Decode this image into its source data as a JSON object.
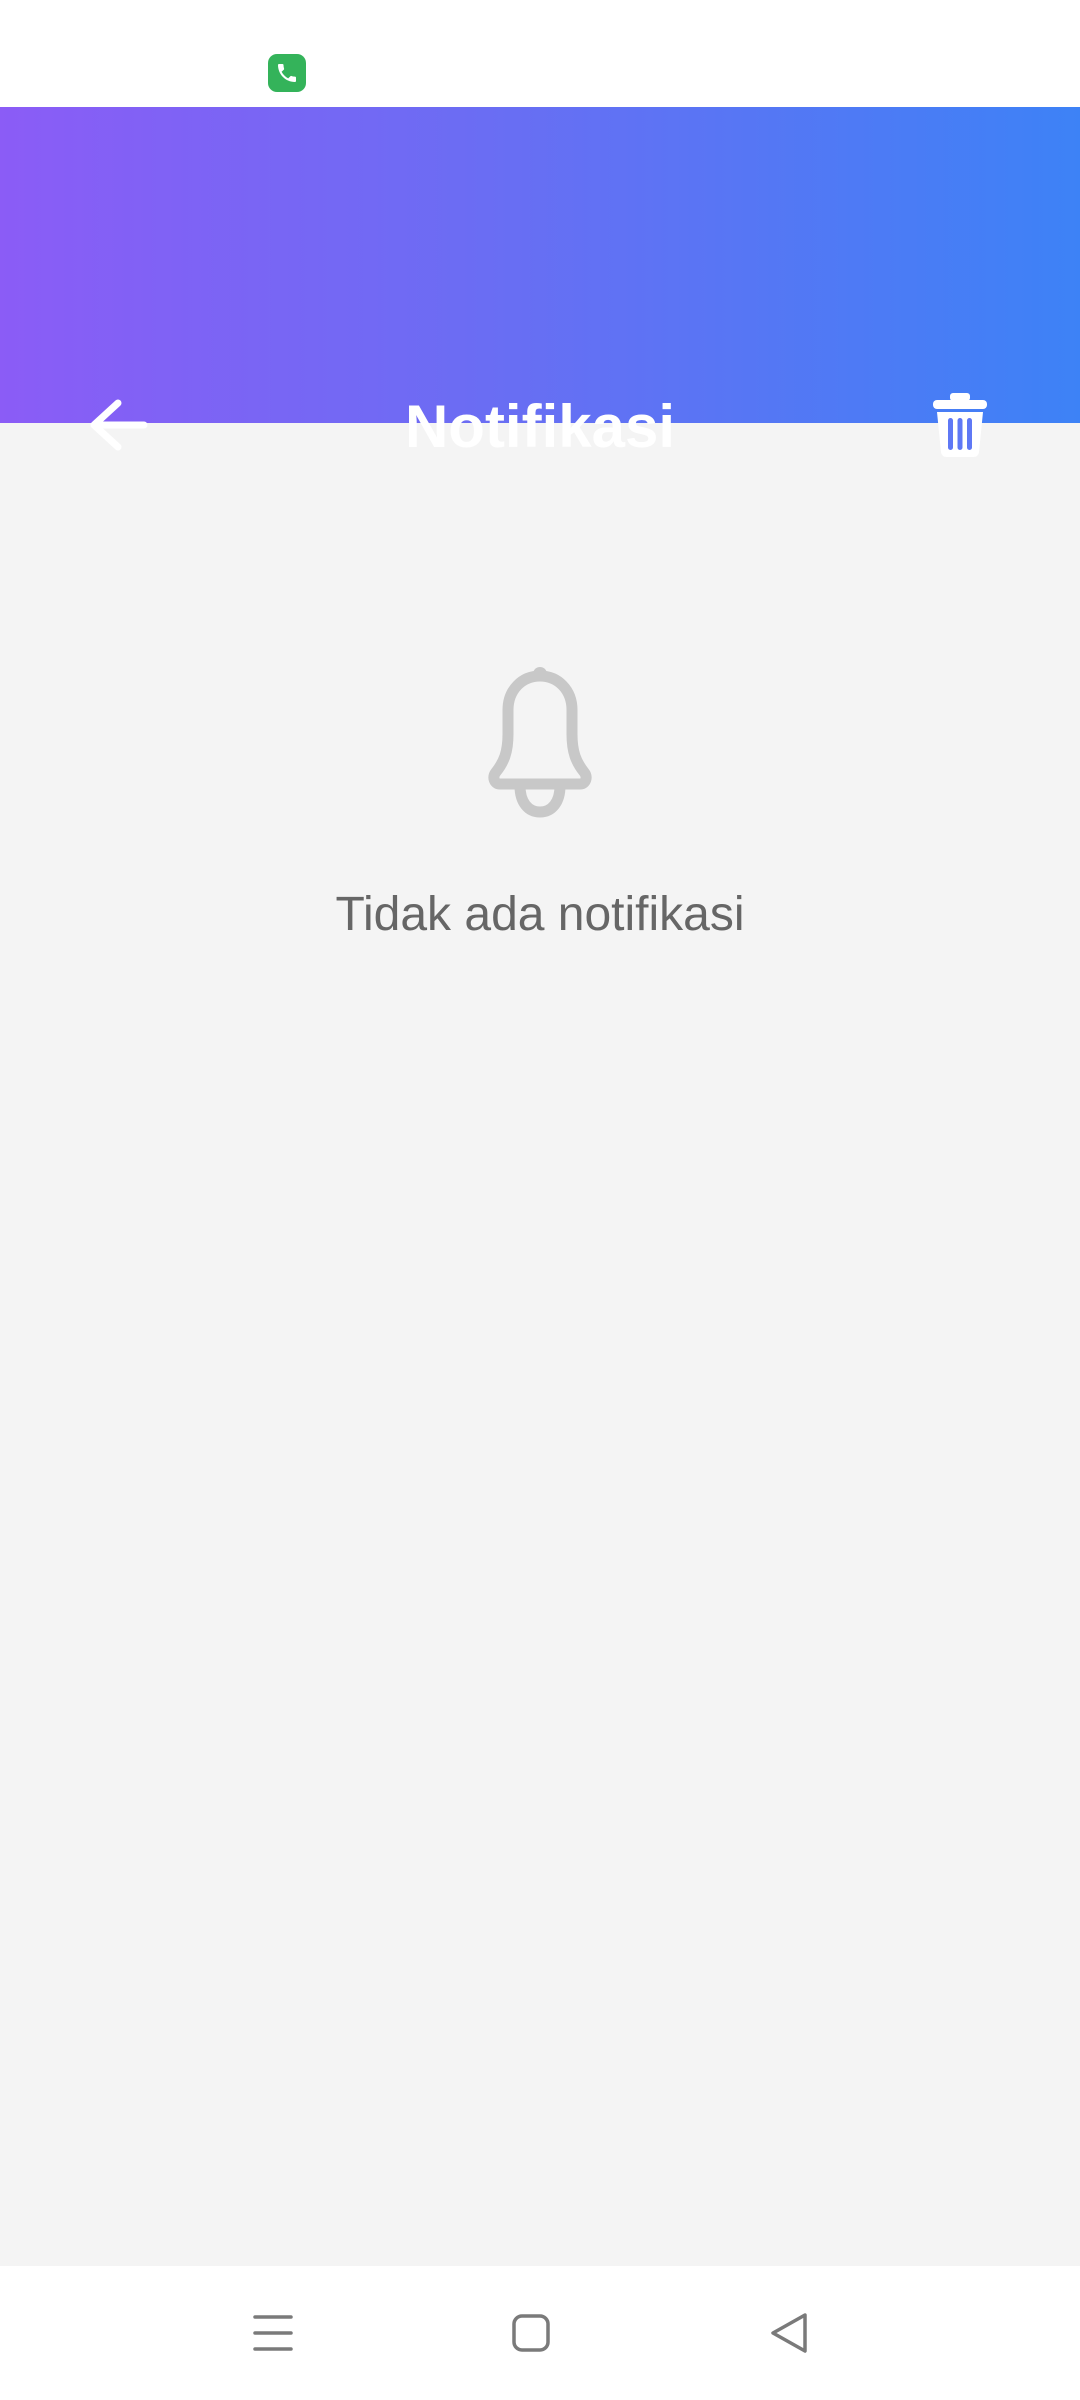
{
  "header": {
    "title": "Notifikasi",
    "back_icon": "arrow-left-icon",
    "delete_icon": "trash-icon",
    "gradient_start": "#8b5cf6",
    "gradient_end": "#3d82f6"
  },
  "status_bar": {
    "notification_icon": "phone-call-icon",
    "notification_icon_color": "#34b35a"
  },
  "empty_state": {
    "icon": "bell-icon",
    "message": "Tidak ada notifikasi"
  },
  "nav_bar": {
    "buttons": [
      "menu-icon",
      "home-icon",
      "back-triangle-icon"
    ]
  }
}
